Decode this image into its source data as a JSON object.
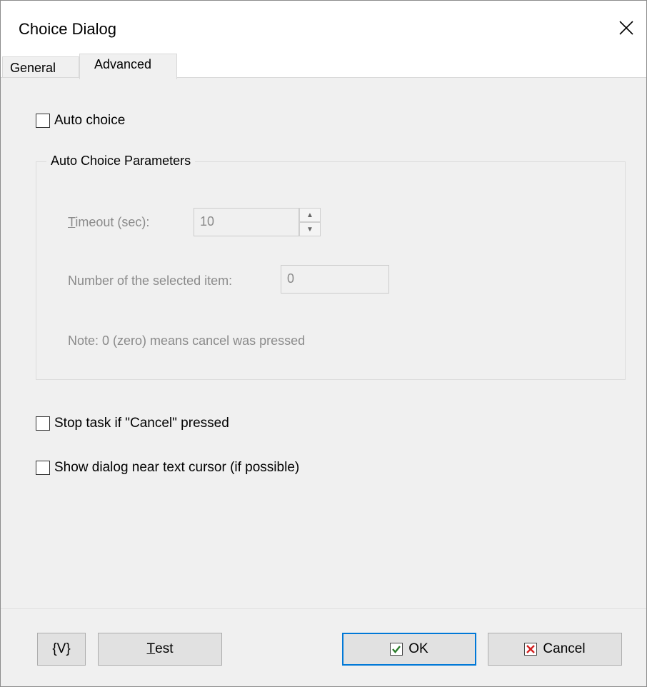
{
  "window": {
    "title": "Choice Dialog"
  },
  "tabs": [
    {
      "label": "General"
    },
    {
      "label": "Advanced"
    }
  ],
  "advanced": {
    "auto_choice_label": "Auto choice",
    "group_title": "Auto Choice Parameters",
    "timeout_label": "Timeout (sec):",
    "timeout_value": "10",
    "selected_item_label": "Number of the selected item:",
    "selected_item_value": "0",
    "note": "Note: 0 (zero) means cancel was pressed",
    "stop_task_label": "Stop task if \"Cancel\" pressed",
    "show_near_cursor_label": "Show dialog near text cursor (if possible)"
  },
  "buttons": {
    "variables": "{V}",
    "test": "Test",
    "ok": "OK",
    "cancel": "Cancel"
  },
  "colors": {
    "ok_check": "#2a7c2a",
    "cancel_x": "#d22222",
    "focus_border": "#0078d7"
  }
}
